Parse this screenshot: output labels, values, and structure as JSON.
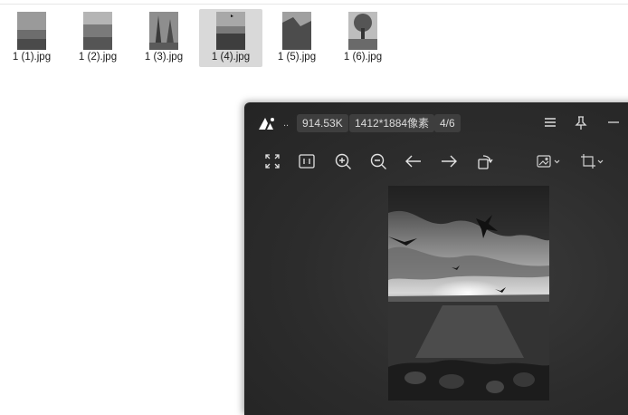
{
  "files": [
    {
      "name": "1 (1).jpg",
      "selected": false
    },
    {
      "name": "1 (2).jpg",
      "selected": false
    },
    {
      "name": "1 (3).jpg",
      "selected": false
    },
    {
      "name": "1 (4).jpg",
      "selected": true
    },
    {
      "name": "1 (5).jpg",
      "selected": false
    },
    {
      "name": "1 (6).jpg",
      "selected": false
    }
  ],
  "viewer": {
    "title_ellipsis": "..",
    "file_size": "914.53K",
    "dimensions": "1412*1884像素",
    "position": "4/6",
    "titlebar_icons": [
      "menu-icon",
      "pin-icon",
      "minimize-icon"
    ],
    "toolbar": [
      "fullscreen-icon",
      "actual-size-icon",
      "zoom-in-icon",
      "zoom-out-icon",
      "previous-icon",
      "next-icon",
      "rotate-icon",
      "image-edit-dropdown-icon",
      "crop-dropdown-icon"
    ]
  }
}
